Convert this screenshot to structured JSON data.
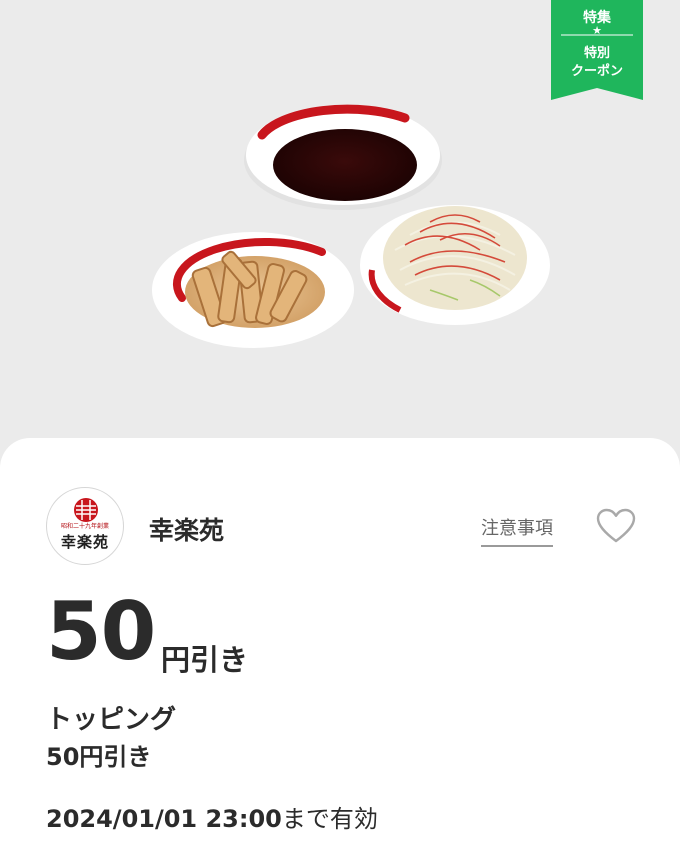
{
  "badge": {
    "line1": "特集",
    "star": "★",
    "line2": "特別",
    "line3": "クーポン",
    "color": "#1fb65c"
  },
  "hero": {
    "images": [
      "soy-sauce-dish",
      "menma-dish",
      "negi-dish"
    ]
  },
  "shop": {
    "logo_small_text": "昭和二十九年創業",
    "logo_name": "幸楽苑",
    "name": "幸楽苑"
  },
  "notes_link": "注意事項",
  "favorite_icon": "heart-outline-icon",
  "coupon": {
    "amount": "50",
    "amount_unit": "円引き",
    "item_title": "トッピング",
    "item_sub": "50円引き",
    "valid_date": "2024/01/01 23:00",
    "valid_suffix": "まで有効"
  },
  "colors": {
    "accent_red": "#c8161d",
    "badge_green": "#1fb65c",
    "text": "#2b2b2b"
  }
}
